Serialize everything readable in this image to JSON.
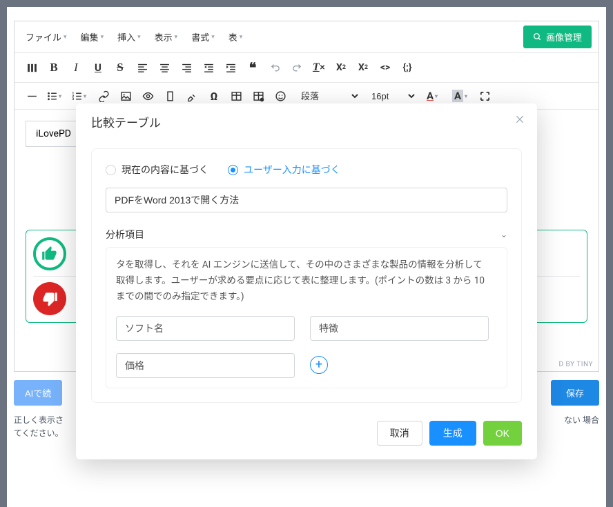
{
  "menubar": {
    "items": [
      "ファイル",
      "編集",
      "挿入",
      "表示",
      "書式",
      "表"
    ],
    "image_manager": "画像管理"
  },
  "toolbar": {
    "paragraph_select": "段落",
    "fontsize_select": "16pt"
  },
  "editor_content": {
    "cell_text": "iLovePD"
  },
  "powered_by": "D BY TINY",
  "bottom": {
    "ai_continue": "AIで続",
    "save": "保存",
    "hint_line1": "正しく表示さ",
    "hint_line2": "てください。",
    "hint_right": "ない 場合"
  },
  "modal": {
    "title": "比較テーブル",
    "radio_current": "現在の内容に基づく",
    "radio_user": "ユーザー入力に基づく",
    "topic_value": "PDFをWord 2013で開く方法",
    "section_header": "分析項目",
    "desc": "タを取得し、それを AI エンジンに送信して、その中のさまざまな製品の情報を分析して取得します。ユーザーが求める要点に応じて表に整理します。(ポイントの数は 3 から 10 までの間でのみ指定できます。)",
    "fields": {
      "f1": "ソフト名",
      "f2": "特徴",
      "f3": "価格"
    },
    "footer": {
      "cancel": "取消",
      "generate": "生成",
      "ok": "OK"
    }
  }
}
